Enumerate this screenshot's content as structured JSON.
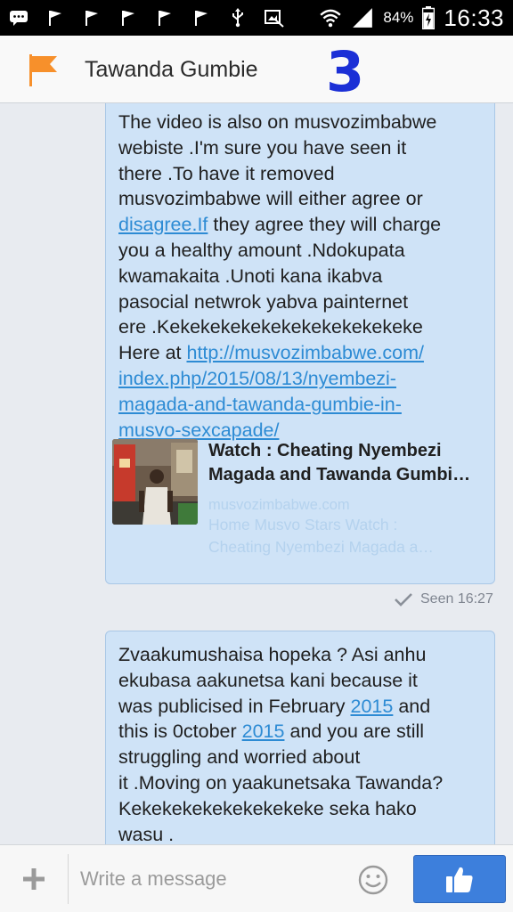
{
  "status_bar": {
    "battery_percent": "84%",
    "time": "16:33",
    "left_icons": [
      "chat-bubble-icon",
      "flag-icon",
      "flag-icon",
      "flag-icon",
      "flag-icon",
      "flag-icon",
      "usb-icon",
      "screenshot-icon"
    ],
    "right_icons": [
      "wifi-icon",
      "signal-icon",
      "battery-charging-icon"
    ]
  },
  "header": {
    "contact_name": "Tawanda Gumbie",
    "annotation_number": "3",
    "flag_color": "#f7902b"
  },
  "messages": [
    {
      "text_parts": [
        "The video is also on musvozimbabwe\nwebiste .I'm sure you have seen it\nthere .To have it removed\nmusvozimbabwe  will either agree or\n",
        "disagree.If",
        " they agree they will charge\nyou a healthy amount .Ndokupata\nkwamakaita .Unoti kana ikabva\npasocial netwrok yabva painternet\nere .Kekekekekekekekekekekekeke\nHere at  ",
        "http://musvozimbabwe.com/\nindex.php/2015/08/13/nyembezi-\nmagada-and-tawanda-gumbie-in-\nmusvo-sexcapade/"
      ],
      "link_preview": {
        "title": "Watch : Cheating Nyembezi\nMagada and Tawanda Gumbi…",
        "domain": "musvozimbabwe.com",
        "description": "Home Musvo Stars Watch :\nCheating Nyembezi Magada a…"
      },
      "seen_label": "Seen 16:27"
    },
    {
      "text_parts": [
        "Zvaakumushaisa hopeka ? Asi anhu\nekubasa aakunetsa kani because it\nwas publicised in February ",
        "2015",
        " and\nthis is 0ctober ",
        "2015",
        " and you are still\nstruggling and worried about\nit .Moving on yaakunetsaka Tawanda?\nKekekekekekekekekeke seka hako\nwasu ."
      ]
    }
  ],
  "composer": {
    "placeholder": "Write a message"
  },
  "colors": {
    "bubble": "#cfe3f7",
    "link": "#2d8bd4",
    "like_button": "#3d7fdc",
    "annotation": "#1b2fd6"
  }
}
